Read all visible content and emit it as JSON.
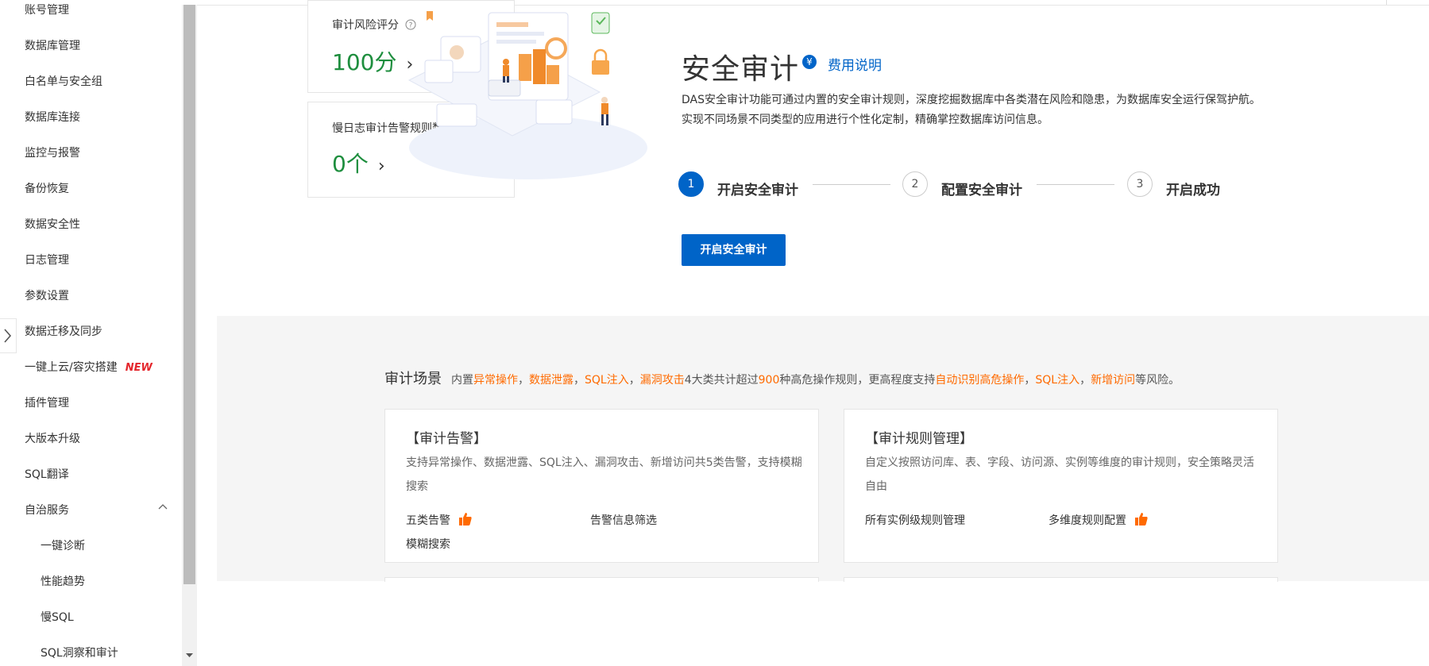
{
  "sidebar": {
    "items": [
      {
        "label": "账号管理"
      },
      {
        "label": "数据库管理"
      },
      {
        "label": "白名单与安全组"
      },
      {
        "label": "数据库连接"
      },
      {
        "label": "监控与报警"
      },
      {
        "label": "备份恢复"
      },
      {
        "label": "数据安全性"
      },
      {
        "label": "日志管理"
      },
      {
        "label": "参数设置"
      },
      {
        "label": "数据迁移及同步"
      },
      {
        "label": "一键上云/容灾搭建",
        "badge": "NEW"
      },
      {
        "label": "插件管理"
      },
      {
        "label": "大版本升级"
      },
      {
        "label": "SQL翻译"
      },
      {
        "label": "自治服务"
      }
    ],
    "subitems": [
      {
        "label": "一键诊断"
      },
      {
        "label": "性能趋势"
      },
      {
        "label": "慢SQL"
      },
      {
        "label": "SQL洞察和审计"
      }
    ]
  },
  "metrics": {
    "risk_score": {
      "label": "审计风险评分",
      "value": "100分"
    },
    "slow_log_rules": {
      "label": "慢日志审计告警规则数",
      "value": "0个"
    }
  },
  "header": {
    "title": "安全审计",
    "fee_icon": "¥",
    "fee_link": "费用说明",
    "desc_line1": "DAS安全审计功能可通过内置的安全审计规则，深度挖掘数据库中各类潜在风险和隐患，为数据库安全运行保驾护航。",
    "desc_line2": "实现不同场景不同类型的应用进行个性化定制，精确掌控数据库访问信息。"
  },
  "steps": [
    {
      "num": "1",
      "label": "开启安全审计",
      "active": true
    },
    {
      "num": "2",
      "label": "配置安全审计",
      "active": false
    },
    {
      "num": "3",
      "label": "开启成功",
      "active": false
    }
  ],
  "primary_button": "开启安全审计",
  "scene": {
    "title": "审计场景",
    "p1": "内置",
    "h1": "异常操作",
    "p2": "，",
    "h2": "数据泄露",
    "p3": "，",
    "h3": "SQL注入",
    "p4": "，",
    "h4": "漏洞攻击",
    "p5": "4大类共计超过",
    "h5": "900",
    "p6": "种高危操作规则，更高程度支持",
    "h6": "自动识别高危操作",
    "p7": "，",
    "h7": "SQL注入",
    "p8": "，",
    "h8": "新增访问",
    "p9": "等风险。"
  },
  "features": [
    {
      "title": "【审计告警】",
      "desc": "支持异常操作、数据泄露、SQL注入、漏洞攻击、新增访问共5类告警，支持模糊搜索",
      "tags": [
        "五类告警",
        "告警信息筛选",
        "模糊搜索"
      ]
    },
    {
      "title": "【审计规则管理】",
      "desc": "自定义按照访问库、表、字段、访问源、实例等维度的审计规则，安全策略灵活自由",
      "tags": [
        "所有实例级规则管理",
        "多维度规则配置"
      ]
    }
  ],
  "colors": {
    "primary": "#0064c8",
    "accent": "#ff6a00",
    "success": "#1e8e3e",
    "new_badge": "#e4262c"
  }
}
